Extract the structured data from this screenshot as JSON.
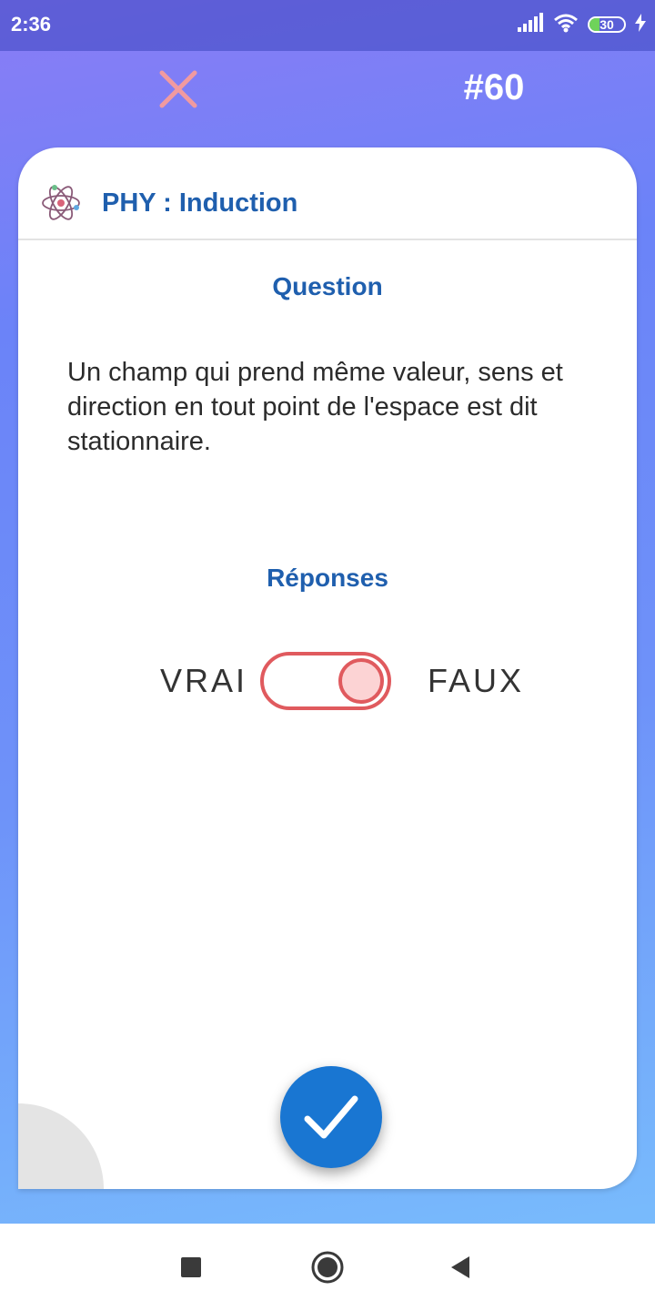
{
  "status_bar": {
    "time": "2:36",
    "battery_level": "30",
    "battery_fraction": 0.3,
    "signal_icon": "signal-icon",
    "wifi_icon": "wifi-icon",
    "charging_icon": "charging-bolt-icon"
  },
  "top_bar": {
    "close_icon": "close-icon",
    "card_number": "#60"
  },
  "card": {
    "subject_icon": "atom-icon",
    "subject_title": "PHY : Induction",
    "question_heading": "Question",
    "question_text": "Un champ qui prend même valeur, sens et direction en tout point de l'espace est dit stationnaire.",
    "answers_heading": "Réponses",
    "answer_true_label": "VRAI",
    "answer_false_label": "FAUX",
    "toggle_state": "FAUX",
    "submit_icon": "checkmark-icon"
  },
  "colors": {
    "accent_blue": "#1f5fae",
    "submit_blue": "#1976d2",
    "toggle_red": "#e05a5e",
    "close_pink": "#f19aa0",
    "battery_green": "#6fd35a"
  },
  "nav_bar": {
    "recent_icon": "square-recents-icon",
    "home_icon": "circle-home-icon",
    "back_icon": "triangle-back-icon"
  }
}
